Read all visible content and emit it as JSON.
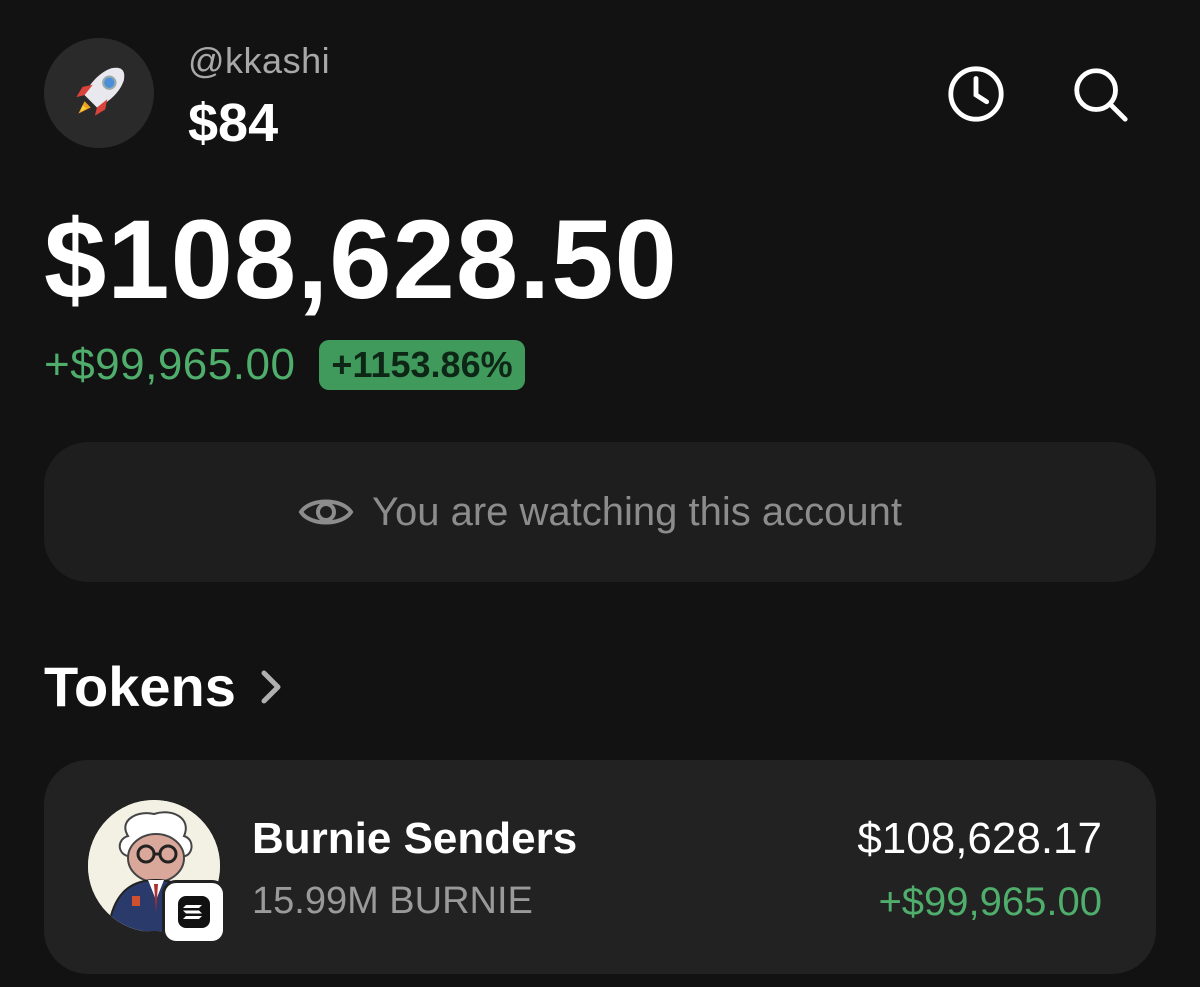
{
  "header": {
    "avatar_icon": "rocket-icon",
    "handle": "@kkashi",
    "small_balance": "$84",
    "history_icon": "clock-icon",
    "search_icon": "search-icon"
  },
  "portfolio": {
    "total_balance": "$108,628.50",
    "change_amount": "+$99,965.00",
    "change_percent": "+1153.86%"
  },
  "watch_banner": {
    "icon": "eye-icon",
    "text": "You are watching this account"
  },
  "tokens_section": {
    "title": "Tokens",
    "chevron_icon": "chevron-right-icon",
    "items": [
      {
        "name": "Burnie Senders",
        "amount": "15.99M BURNIE",
        "value": "$108,628.17",
        "change": "+$99,965.00",
        "chain_icon": "solana-icon"
      }
    ]
  },
  "colors": {
    "background": "#121212",
    "card": "#1e1e1e",
    "positive": "#4fae6c",
    "badge": "#3f9a5c",
    "muted_text": "#8c8c8c"
  }
}
